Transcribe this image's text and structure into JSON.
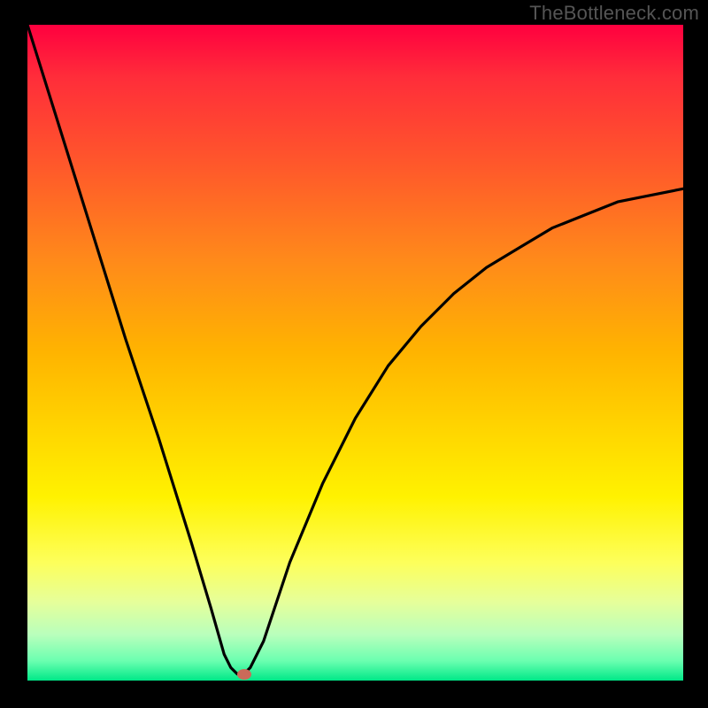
{
  "watermark": "TheBottleneck.com",
  "chart_data": {
    "type": "line",
    "title": "",
    "xlabel": "",
    "ylabel": "",
    "xlim": [
      0,
      100
    ],
    "ylim": [
      0,
      100
    ],
    "grid": false,
    "legend": false,
    "series": [
      {
        "name": "curve",
        "x": [
          0,
          5,
          10,
          15,
          20,
          25,
          28,
          30,
          31,
          32,
          33,
          34,
          36,
          40,
          45,
          50,
          55,
          60,
          65,
          70,
          75,
          80,
          85,
          90,
          95,
          100
        ],
        "values": [
          100,
          84,
          68,
          52,
          37,
          21,
          11,
          4,
          2,
          1,
          1,
          2,
          6,
          18,
          30,
          40,
          48,
          54,
          59,
          63,
          66,
          69,
          71,
          73,
          74,
          75
        ]
      }
    ],
    "marker": {
      "x": 33,
      "y": 1
    },
    "background_gradient": {
      "top": "#ff003f",
      "mid_top": "#ff8a1a",
      "mid": "#ffd600",
      "mid_bottom": "#fdff5b",
      "bottom": "#00e888"
    },
    "curve_color": "#000000",
    "marker_color": "#cb6a59",
    "frame_color": "#000000"
  }
}
